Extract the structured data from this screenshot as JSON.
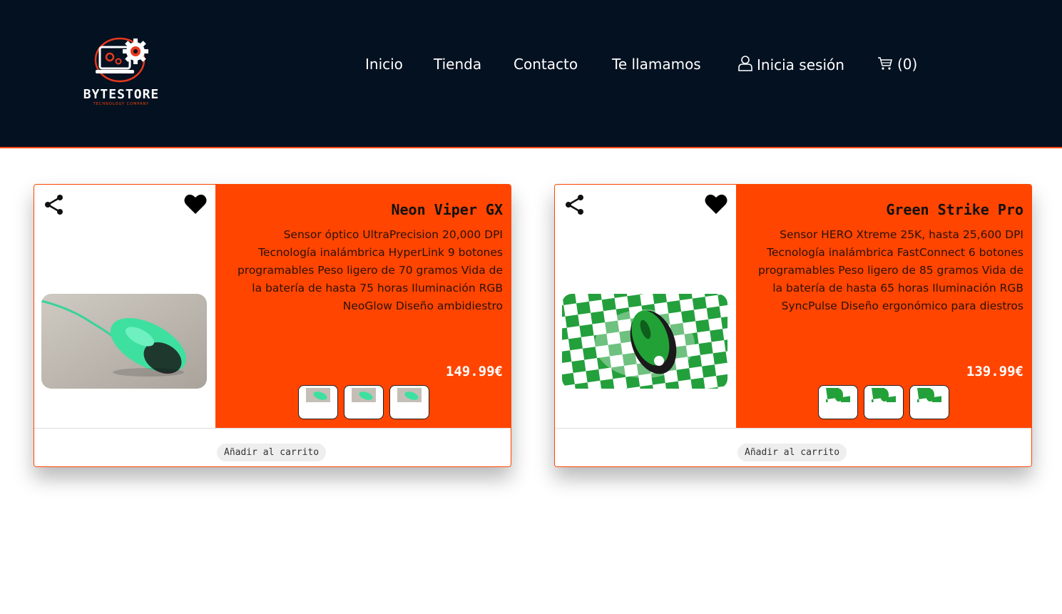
{
  "logo": {
    "name": "BYTESTORE",
    "tagline": "TECHNOLOGY COMPANY"
  },
  "nav": {
    "items": [
      "Inicio",
      "Tienda",
      "Contacto",
      "Te llamamos"
    ],
    "login": "Inicia sesión",
    "cart": "(0)"
  },
  "colors": {
    "header_bg": "#041121",
    "accent": "#ff4500"
  },
  "icons": [
    "user-icon",
    "cart-icon",
    "share-icon",
    "heart-icon"
  ],
  "products": [
    {
      "title": "Neon Viper GX",
      "description": "Sensor óptico UltraPrecision 20,000 DPI Tecnología inalámbrica HyperLink 9 botones programables Peso ligero de 70 gramos Vida de la batería de hasta 75 horas Iluminación RGB NeoGlow Diseño ambidiestro",
      "price": "149.99€",
      "button": "Añadir al carrito"
    },
    {
      "title": "Green Strike Pro",
      "description": "Sensor HERO Xtreme 25K, hasta 25,600 DPI Tecnología inalámbrica FastConnect 6 botones programables Peso ligero de 85 gramos Vida de la batería de hasta 65 horas Iluminación RGB SyncPulse Diseño ergonómico para diestros",
      "price": "139.99€",
      "button": "Añadir al carrito"
    }
  ]
}
